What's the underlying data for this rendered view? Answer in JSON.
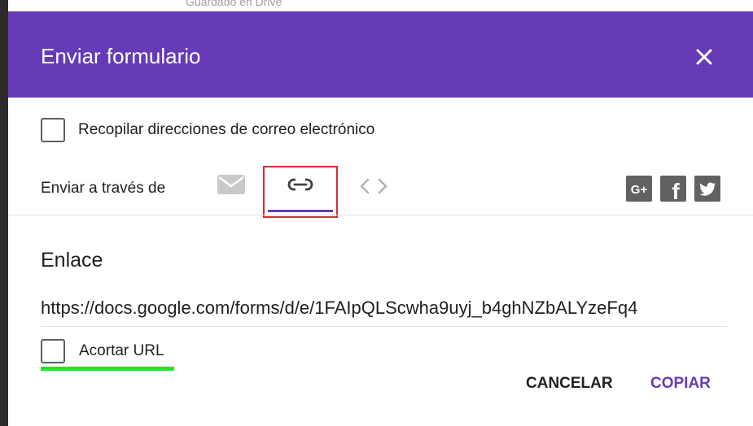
{
  "backdrop": {
    "partial_text": "Guardado en Drive"
  },
  "dialog": {
    "title": "Enviar formulario",
    "collect_emails_label": "Recopilar direcciones de correo electrónico",
    "send_via_label": "Enviar a través de",
    "tabs": [
      {
        "id": "email",
        "icon": "email-icon"
      },
      {
        "id": "link",
        "icon": "link-icon",
        "selected": true
      },
      {
        "id": "embed",
        "icon": "embed-code-icon"
      }
    ],
    "social": [
      {
        "id": "google-plus",
        "text": "G+"
      },
      {
        "id": "facebook",
        "text": "f"
      },
      {
        "id": "twitter",
        "icon": "twitter-bird-icon"
      }
    ],
    "link_section_title": "Enlace",
    "link_url": "https://docs.google.com/forms/d/e/1FAIpQLScwha9uyj_b4ghNZbALYzeFq4",
    "shorten_url_label": "Acortar URL",
    "cancel_label": "CANCELAR",
    "copy_label": "COPIAR"
  },
  "colors": {
    "header": "#673ab7",
    "accent": "#673ab7",
    "highlight_box": "#d32f2f",
    "annotation_underline": "#22e32b",
    "social_icon_bg": "#616161"
  }
}
